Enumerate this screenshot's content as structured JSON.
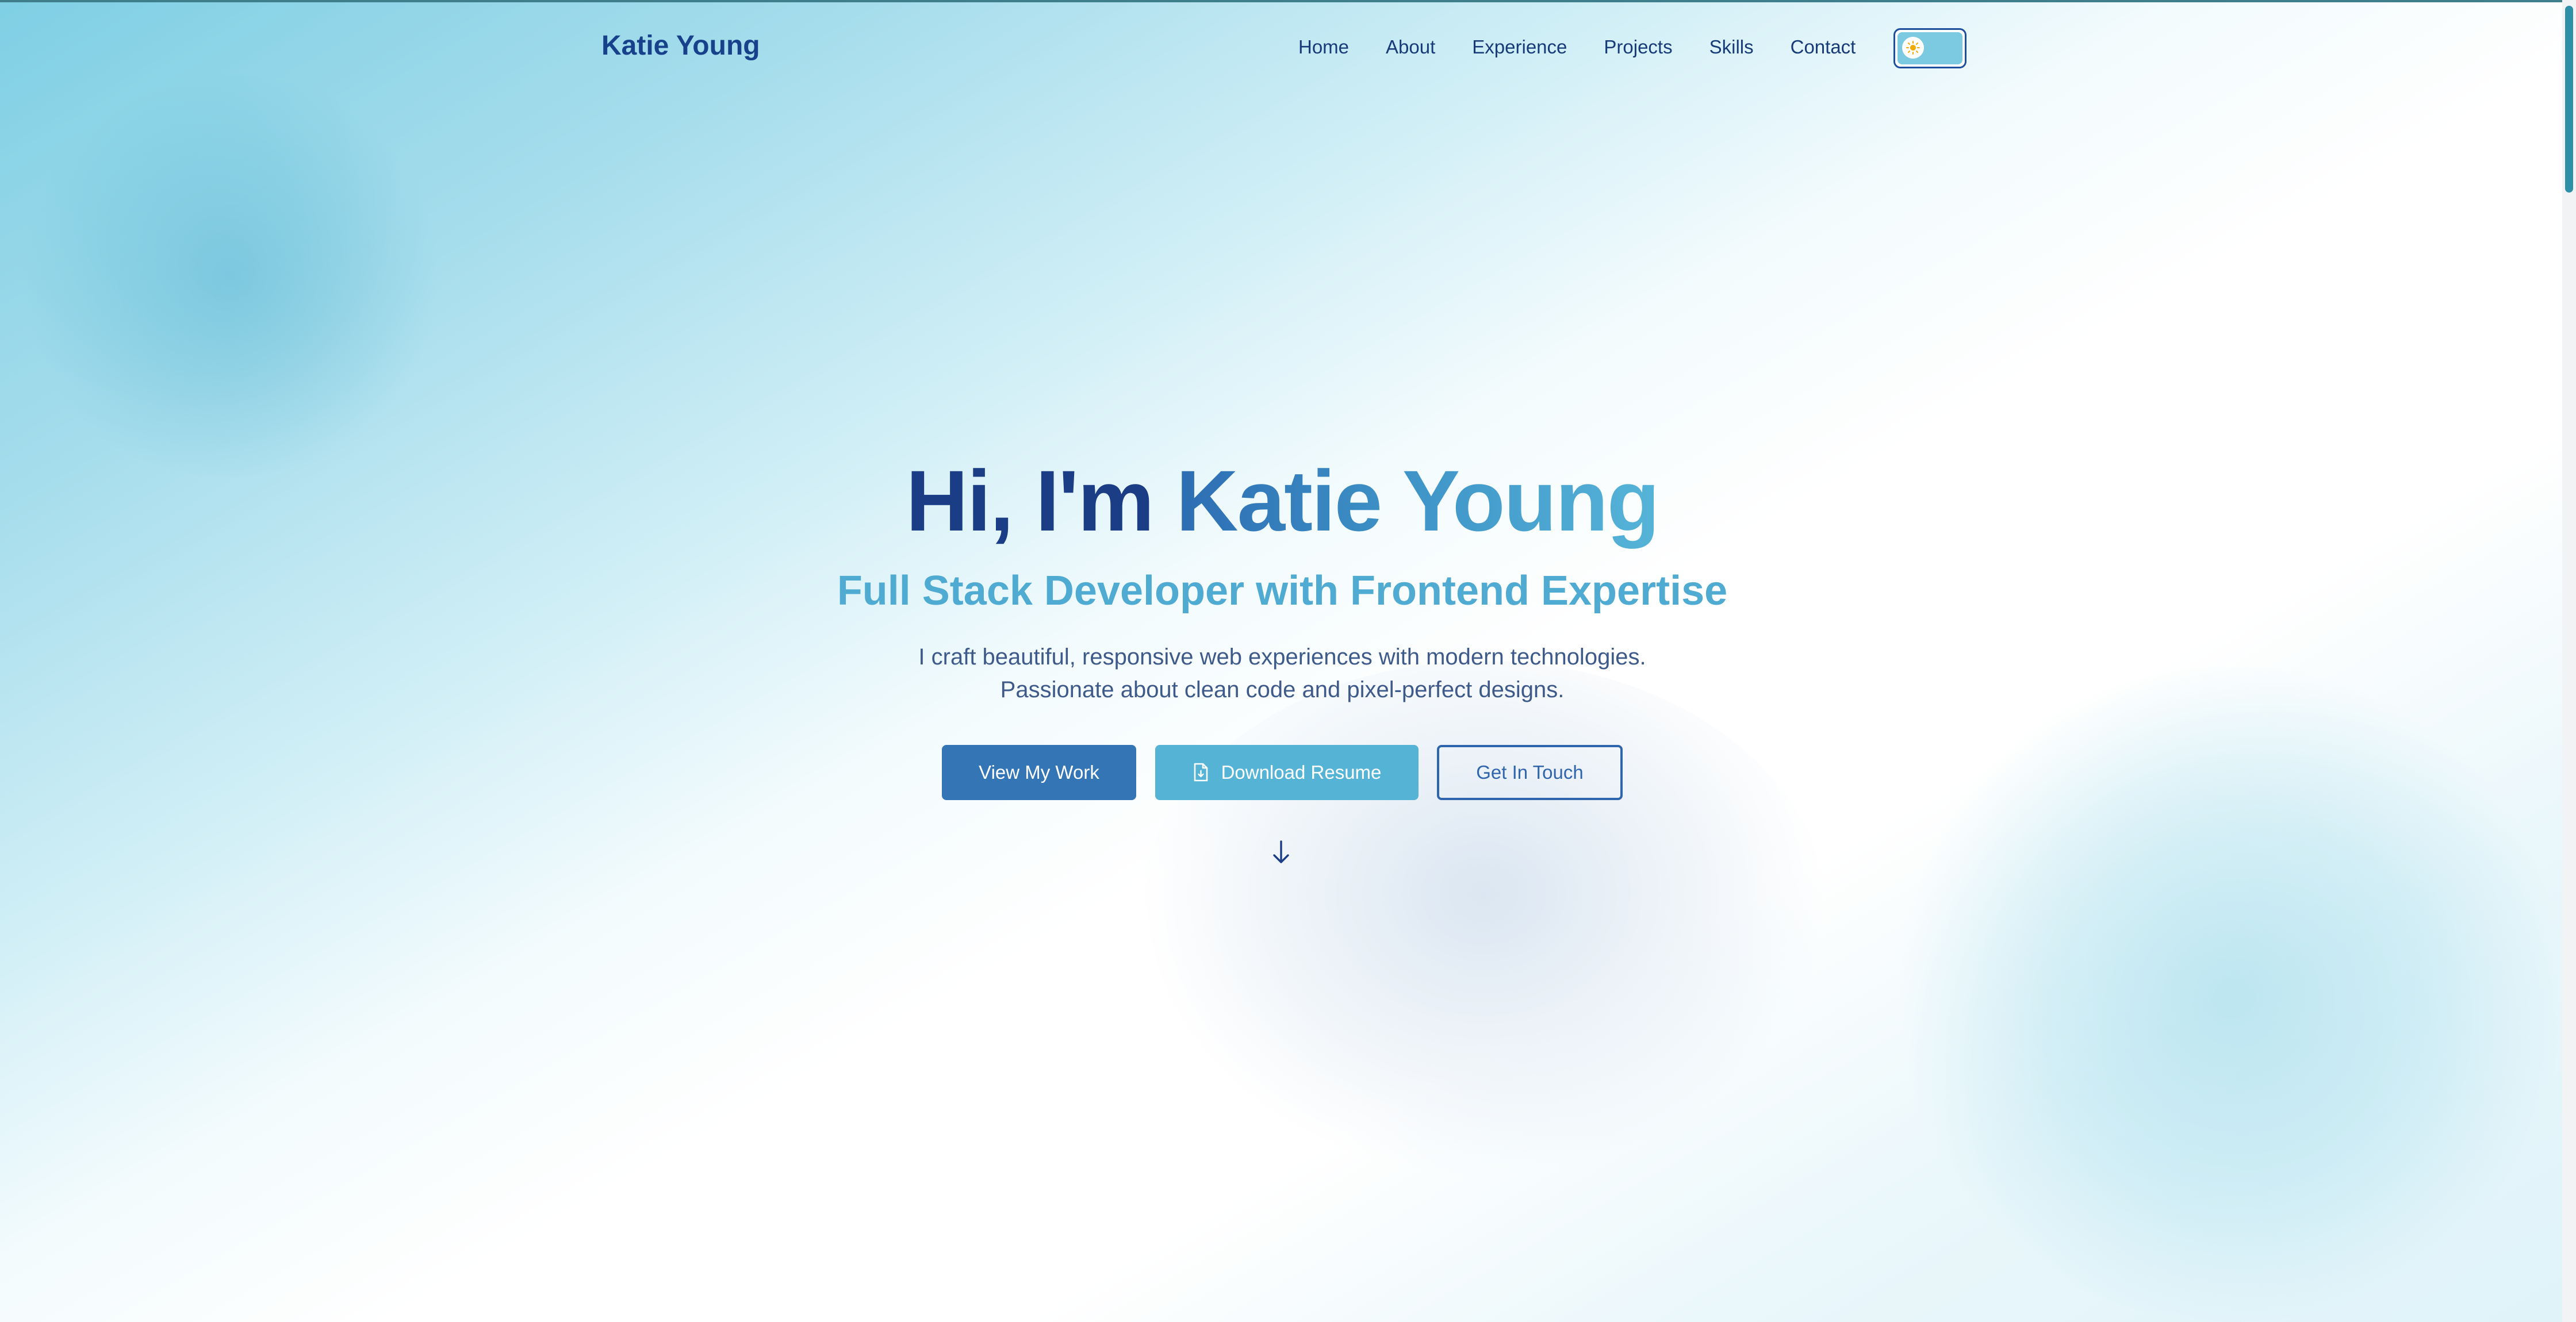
{
  "brand": {
    "name": "Katie Young"
  },
  "nav": {
    "items": [
      {
        "label": "Home"
      },
      {
        "label": "About"
      },
      {
        "label": "Experience"
      },
      {
        "label": "Projects"
      },
      {
        "label": "Skills"
      },
      {
        "label": "Contact"
      }
    ],
    "theme_toggle_icon": "sun-icon"
  },
  "hero": {
    "greeting": "Hi, I'm",
    "name": "Katie Young",
    "subtitle": "Full Stack Developer with Frontend Expertise",
    "description_line1": "I craft beautiful, responsive web experiences with modern technologies.",
    "description_line2": "Passionate about clean code and pixel-perfect designs.",
    "buttons": {
      "view_work": "View My Work",
      "download_resume": "Download Resume",
      "get_in_touch": "Get In Touch"
    },
    "scroll_icon": "arrow-down-icon"
  },
  "colors": {
    "brand": "#17418a",
    "accent": "#55b3d6",
    "primary_button": "#3375b5",
    "scrollbar_thumb": "#2f8fa8"
  }
}
